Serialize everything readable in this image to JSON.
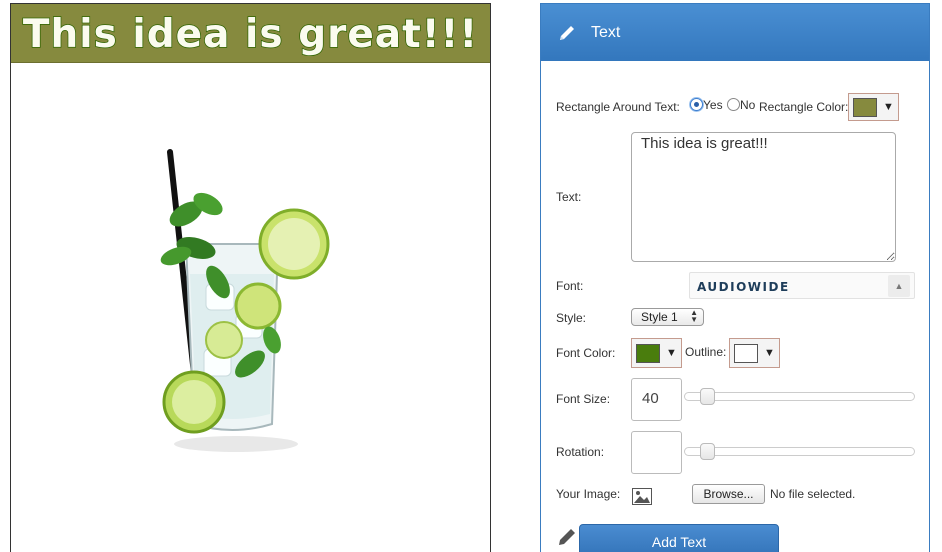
{
  "preview": {
    "banner_text": "This idea is great!!!",
    "banner_color": "#868a3e",
    "banner_text_color": "#fbfbef",
    "banner_outline_color": "#2f6400",
    "image_icon": "mojito-glass-image"
  },
  "panel": {
    "title": "Text",
    "title_icon": "pencil-icon",
    "header_color": "#3a7cc0",
    "rect_label": "Rectangle Around Text:",
    "rect_options": {
      "yes": "Yes",
      "no": "No",
      "selected": "Yes"
    },
    "rect_color_label": "Rectangle Color:",
    "rect_color": "#868a3e",
    "text_label": "Text:",
    "text_value": "This idea is great!!!",
    "font_label": "Font:",
    "font_value": "AUDIOWIDE",
    "style_label": "Style:",
    "style_value": "Style 1",
    "font_color_label": "Font Color:",
    "font_color": "#4a7d0d",
    "outline_label": "Outline:",
    "outline_color": "#ffffff",
    "font_size_label": "Font Size:",
    "font_size_value": "40",
    "font_size_level": 0.05,
    "rotation_label": "Rotation:",
    "rotation_value": "",
    "rotation_level": 0.05,
    "your_image_label": "Your Image:",
    "browse_label": "Browse...",
    "no_file_text": "No file selected.",
    "add_button_label": "Add Text"
  }
}
